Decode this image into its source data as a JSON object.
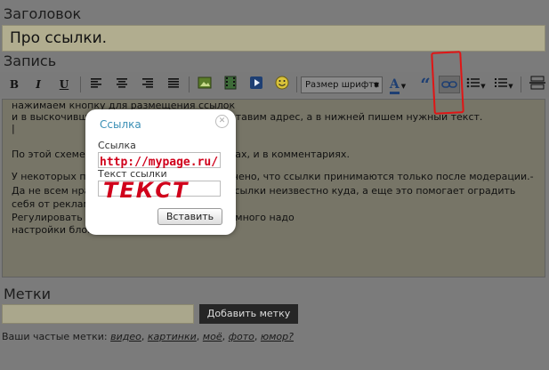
{
  "labels": {
    "title_label": "Заголовок",
    "post_label": "Запись",
    "tags_label": "Метки"
  },
  "title_input": {
    "value": "Про ссылки."
  },
  "toolbar": {
    "bold": "B",
    "italic": "I",
    "underline": "U",
    "font_size_select": "Размер шрифта",
    "text_color_letter": "A",
    "quote_symbol": "“",
    "icons": [
      "bold-icon",
      "italic-icon",
      "underline-icon",
      "align-left-icon",
      "align-center-icon",
      "align-right-icon",
      "align-justify-icon",
      "image-icon",
      "film-icon",
      "video-play-icon",
      "smiley-icon",
      "text-color-icon",
      "quote-icon",
      "link-icon",
      "bullet-list-icon",
      "numbered-list-icon",
      "page-break-icon"
    ]
  },
  "editor": {
    "lines": [
      "нажимаем кнопку для размещения ссылок",
      "и в выскочившем окне в верхней строке вставим адрес, а в нижней пишем нужный текст.",
      "По этой схеме размещаются ссылки в постах, и в комментариях.",
      "У некоторых пользователей в блогах отмечено, что ссылки принимаются только после модерации.-",
      "Да не всем нравятся ссылки, нажатие на ссылки неизвестно куда, а еще это помогает оградить",
      "себя от рекламы.",
      "Регулировать ссылки можно в настройках много надо",
      "настройки блога"
    ]
  },
  "link_dialog": {
    "title": "Ссылка",
    "close_symbol": "✕",
    "link_label": "Ссылка",
    "link_value": "http://mypage.ru/",
    "text_label": "Текст ссылки",
    "text_value": "ТЕКСТ",
    "insert_button": "Вставить"
  },
  "tags": {
    "add_button": "Добавить метку",
    "frequent_prefix": "Ваши частые метки:",
    "frequent": [
      "видео",
      "картинки",
      "моё",
      "фото",
      "юмор?"
    ]
  },
  "colors": {
    "dialog_title": "#3a8fb5",
    "handwriting": "#d0001b",
    "highlight_box": "#e01515"
  }
}
